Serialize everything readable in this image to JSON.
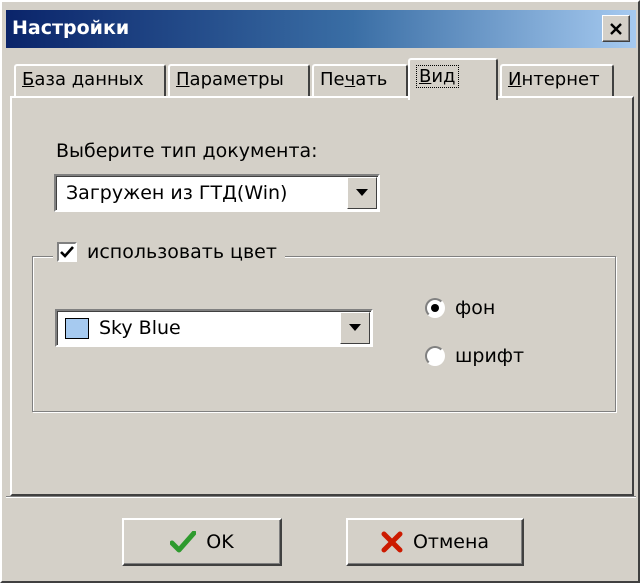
{
  "window": {
    "title": "Настройки",
    "close_glyph": "×"
  },
  "tabs": [
    {
      "label": "База данных",
      "underline": "Б",
      "rest": "аза данных",
      "active": false
    },
    {
      "label": "Параметры",
      "underline": "П",
      "rest": "араметры",
      "active": false
    },
    {
      "label": "Печать",
      "underline": "",
      "rest": "",
      "active": false
    },
    {
      "label": "Вид",
      "underline": "В",
      "rest": "ид",
      "active": true
    },
    {
      "label": "Интернет",
      "underline": "И",
      "rest": "нтернет",
      "active": false
    }
  ],
  "tab_print": {
    "pre": "Пе",
    "ul": "ч",
    "post": "ать"
  },
  "doc_type": {
    "label": "Выберите тип документа:",
    "selected": "Загружен из ГТД(Win)"
  },
  "color_group": {
    "checkbox_label": "использовать цвет",
    "checked": true,
    "color_selected": "Sky Blue",
    "swatch_color": "#a6caf0",
    "radio_background": "фон",
    "radio_font": "шрифт",
    "radio_selected": "фон"
  },
  "buttons": {
    "ok_label": "OK",
    "cancel_label": "Отмена"
  },
  "colors": {
    "title_start": "#0a246a",
    "title_end": "#a6caf0",
    "ok_check": "#2e9a2e",
    "cancel_x": "#cc1a00"
  }
}
